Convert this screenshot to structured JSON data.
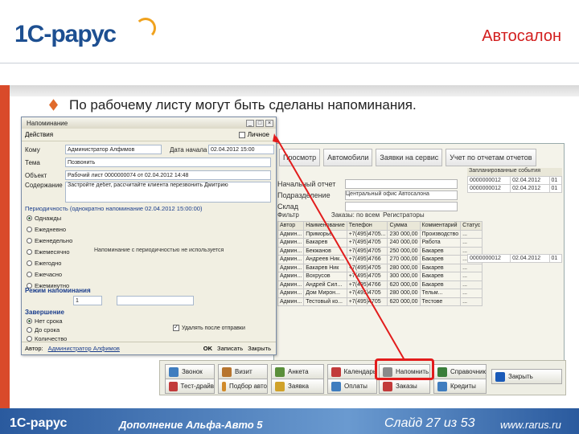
{
  "header": {
    "logo": "1С-рарус",
    "title": "Автосалон"
  },
  "bullet": {
    "text": "По рабочему листу могут быть сделаны напоминания."
  },
  "dialog": {
    "title": "Напоминание",
    "actions_label": "Действия",
    "private_label": "Личное",
    "fields": [
      {
        "label": "Кому",
        "value": "Администратор Алфимов",
        "extra_label": "Дата начала",
        "extra_value": "02.04.2012 15:00"
      },
      {
        "label": "Тема",
        "value": "Позвонить"
      },
      {
        "label": "Объект",
        "value": "Рабочий лист 0000000074 от 02.04.2012 14:48"
      },
      {
        "label": "Содержание",
        "value": "Застройте дебет, рассчитайте клиента  перезвонить Дмитрию"
      }
    ],
    "periodicity": "Периодичность (однократно напоминание 02.04.2012 15:00:00)",
    "radios": [
      "Однажды",
      "Ежедневно",
      "Еженедельно",
      "Ежемесячно",
      "Ежегодно",
      "Ежечасно",
      "Ежеминутно"
    ],
    "periodicity_note": "Напоминание с периодичностью не используется",
    "mode_label": "Режим напоминания",
    "mode_value": "1",
    "finish_label": "Завершение",
    "finish_radios": [
      "Нет срока",
      "До срока",
      "Количество"
    ],
    "delete_after": "Удалять после отправки",
    "footer_author_label": "Автор:",
    "footer_author": "Администратор Алфимов",
    "footer_buttons": [
      "OK",
      "Записать",
      "Закрыть"
    ]
  },
  "main_window": {
    "toolbar": [
      "Просмотр",
      "Автомобили",
      "Заявки на сервис",
      "Учет по отчетам отчетов"
    ],
    "rows": [
      "Начальный отчет",
      "Подразделение",
      "Склад"
    ],
    "row_value": "Центральный офис Автосалона",
    "filter_labels": [
      "Фильтр",
      "Заказы: по всем",
      "Регистраторы"
    ],
    "grid_headers": [
      "Автор",
      "Наименование",
      "Телефон",
      "Сумма",
      "Комментарий",
      "Статус"
    ],
    "grid_rows": [
      [
        "Админ...",
        "Приморье",
        "+7(495)4705...",
        "230 000,00",
        "Производство",
        "..."
      ],
      [
        "Админ...",
        "Бакарев",
        "+7(495)4705",
        "240 000,00",
        "Работа",
        "..."
      ],
      [
        "Админ...",
        "Бекжанов",
        "+7(495)4705",
        "250 000,00",
        "Бакарев",
        "..."
      ],
      [
        "Админ...",
        "Андреев Ник...",
        "+7(495)4766",
        "270 000,00",
        "Бакарев",
        "..."
      ],
      [
        "Админ...",
        "Бакарев Ник",
        "+7(495)4705",
        "280 000,00",
        "Бакарев",
        "..."
      ],
      [
        "Админ...",
        "Вохрусов",
        "+7(495)4705",
        "300 000,00",
        "Бакарев",
        "..."
      ],
      [
        "Админ...",
        "Андрей Сил...",
        "+7(495)4766",
        "620 000,00",
        "Бакарев",
        "..."
      ],
      [
        "Админ...",
        "Дом Мирон...",
        "+7(495)4705",
        "280 000,00",
        "Тельм...",
        "..."
      ],
      [
        "Админ...",
        "Тестовый ко...",
        "+7(495)4705",
        "620 000,00",
        "Тестове",
        "..."
      ]
    ],
    "right_heading": "Запланированные события",
    "right_rows": [
      [
        "0000000012",
        "02.04.2012",
        "01"
      ],
      [
        "0000000012",
        "02.04.2012",
        "01"
      ]
    ],
    "right_rows2": [
      [
        "0000000012",
        "02.04.2012",
        "01"
      ]
    ]
  },
  "launcher": {
    "buttons": [
      {
        "label": "Звонок",
        "color": "#3f7dbf"
      },
      {
        "label": "Визит",
        "color": "#b7752f"
      },
      {
        "label": "Анкета",
        "color": "#5a8f3a"
      },
      {
        "label": "Календарь",
        "color": "#c23b3b"
      },
      {
        "label": "Напомнить",
        "color": "#8a8a8a"
      },
      {
        "label": "Справочник",
        "color": "#3a7e3a"
      },
      {
        "label": "Тест-драйв",
        "color": "#c23b3b"
      },
      {
        "label": "Подбор авто",
        "color": "#d08a2a"
      },
      {
        "label": "Заявка",
        "color": "#d0a22a"
      },
      {
        "label": "Оплаты",
        "color": "#3f7dbf"
      },
      {
        "label": "Заказы",
        "color": "#c23b3b"
      },
      {
        "label": "Кредиты",
        "color": "#3f7dbf"
      },
      {
        "label": "Закрыть",
        "color": "#1a5ab8"
      }
    ]
  },
  "footer": {
    "logo": "1С-рарус",
    "product": "Дополнение Альфа-Авто 5",
    "slide": "Слайд 27 из 53",
    "url": "www.rarus.ru"
  },
  "colors": {
    "accent_red": "#d21e1e",
    "brand_blue": "#1d4f91",
    "brand_orange": "#f0a21e"
  }
}
